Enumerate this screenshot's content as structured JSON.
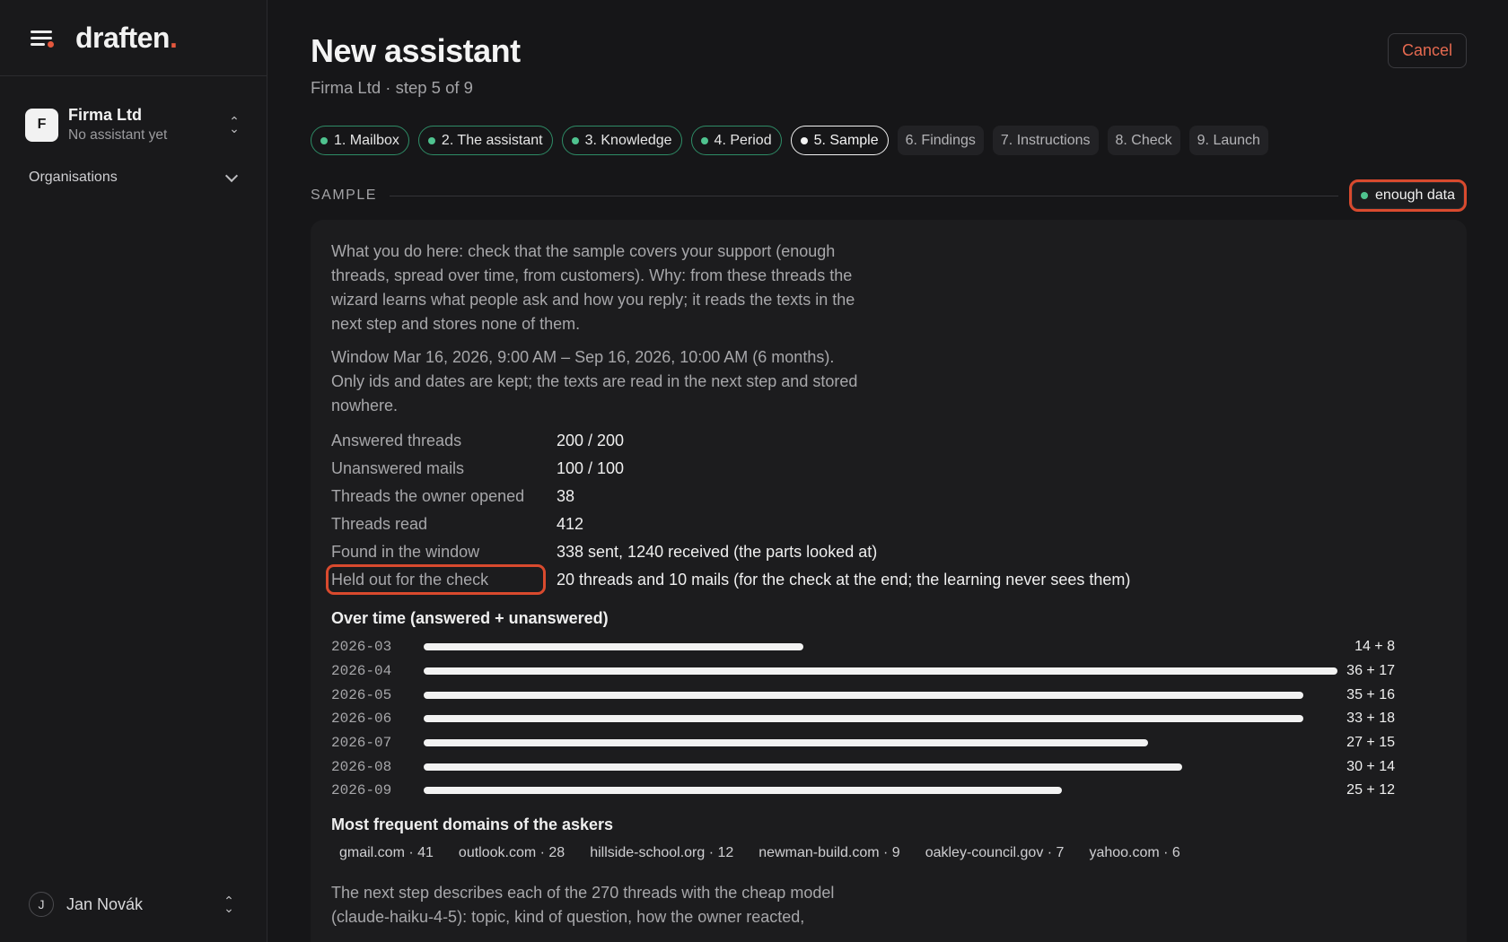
{
  "sidebar": {
    "logo": "draften",
    "logo_dot": ".",
    "org": {
      "initial": "F",
      "name": "Firma Ltd",
      "subtitle": "No assistant yet"
    },
    "organisations_label": "Organisations",
    "user": {
      "initial": "J",
      "name": "Jan Novák"
    }
  },
  "header": {
    "title": "New assistant",
    "subtitle": "Firma Ltd · step 5 of 9",
    "cancel_label": "Cancel"
  },
  "steps": [
    {
      "label": "1. Mailbox",
      "state": "done"
    },
    {
      "label": "2. The assistant",
      "state": "done"
    },
    {
      "label": "3. Knowledge",
      "state": "done"
    },
    {
      "label": "4. Period",
      "state": "done"
    },
    {
      "label": "5. Sample",
      "state": "current"
    },
    {
      "label": "6. Findings",
      "state": "todo"
    },
    {
      "label": "7. Instructions",
      "state": "todo"
    },
    {
      "label": "8. Check",
      "state": "todo"
    },
    {
      "label": "9. Launch",
      "state": "todo"
    }
  ],
  "section": {
    "label": "SAMPLE",
    "badge": "enough data"
  },
  "card": {
    "intro": "What you do here: check that the sample covers your support (enough threads, spread over time, from customers). Why: from these threads the wizard learns what people ask and how you reply; it reads the texts in the next step and stores none of them.",
    "window": "Window Mar 16, 2026, 9:00 AM – Sep 16, 2026, 10:00 AM (6 months). Only ids and dates are kept; the texts are read in the next step and stored nowhere.",
    "stats": [
      {
        "label": "Answered threads",
        "value": "200 / 200"
      },
      {
        "label": "Unanswered mails",
        "value": "100 / 100"
      },
      {
        "label": "Threads the owner opened",
        "value": "38"
      },
      {
        "label": "Threads read",
        "value": "412"
      },
      {
        "label": "Found in the window",
        "value": "338 sent, 1240 received (the parts looked at)"
      },
      {
        "label": "Held out for the check",
        "value": "20 threads and 10 mails (for the check at the end; the learning never sees them)"
      }
    ],
    "over_time_title": "Over time (answered + unanswered)",
    "over_time": [
      {
        "month": "2026-03",
        "answered": 14,
        "unanswered": 8,
        "label": "14 + 8"
      },
      {
        "month": "2026-04",
        "answered": 36,
        "unanswered": 17,
        "label": "36 + 17"
      },
      {
        "month": "2026-05",
        "answered": 35,
        "unanswered": 16,
        "label": "35 + 16"
      },
      {
        "month": "2026-06",
        "answered": 33,
        "unanswered": 18,
        "label": "33 + 18"
      },
      {
        "month": "2026-07",
        "answered": 27,
        "unanswered": 15,
        "label": "27 + 15"
      },
      {
        "month": "2026-08",
        "answered": 30,
        "unanswered": 14,
        "label": "30 + 14"
      },
      {
        "month": "2026-09",
        "answered": 25,
        "unanswered": 12,
        "label": "25 + 12"
      }
    ],
    "domains_title": "Most frequent domains of the askers",
    "domains": [
      "gmail.com · 41",
      "outlook.com · 28",
      "hillside-school.org · 12",
      "newman-build.com · 9",
      "oakley-council.gov · 7",
      "yahoo.com · 6"
    ],
    "next_step": "The next step describes each of the 270 threads with the cheap model (claude-haiku-4-5): topic, kind of question, how the owner reacted,"
  },
  "colors": {
    "accent": "#e4573d",
    "ok": "#4fc38f",
    "highlight": "#d94a2e"
  }
}
